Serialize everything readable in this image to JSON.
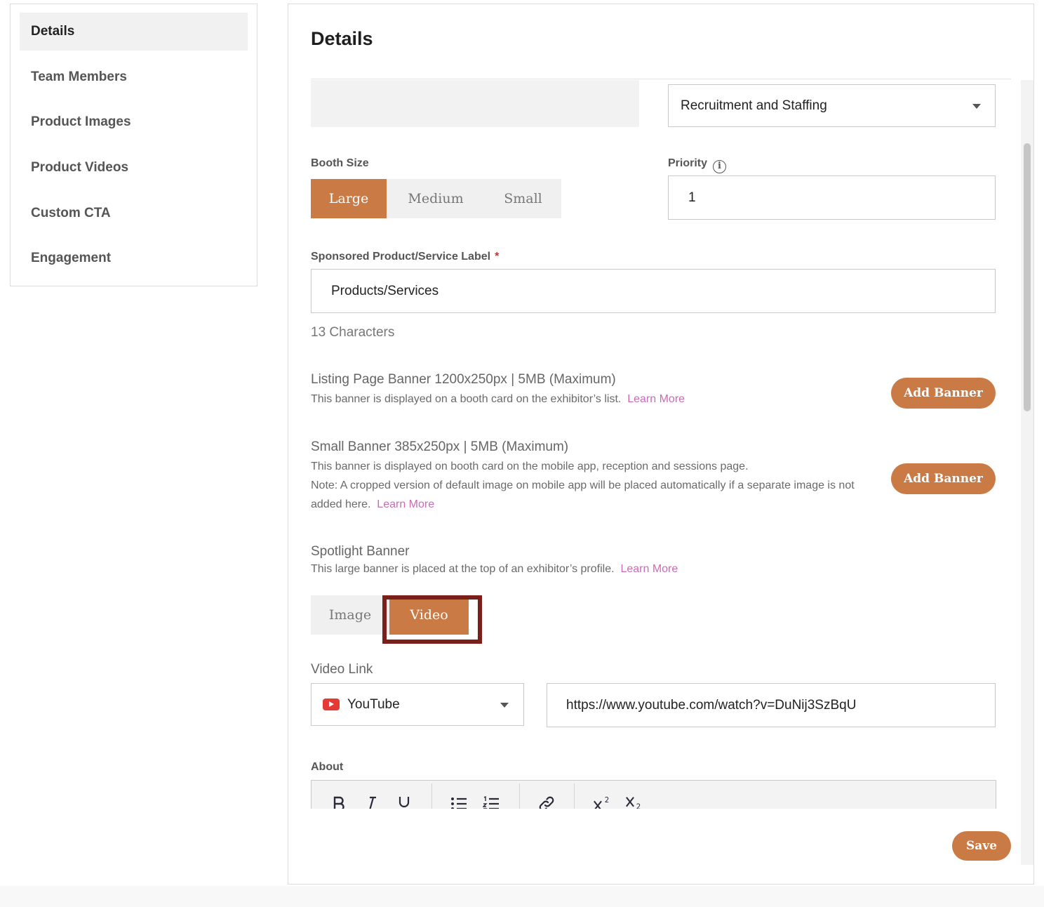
{
  "sidebar": {
    "items": [
      {
        "label": "Details",
        "active": true
      },
      {
        "label": "Team Members"
      },
      {
        "label": "Product Images"
      },
      {
        "label": "Product Videos"
      },
      {
        "label": "Custom CTA"
      },
      {
        "label": "Engagement"
      }
    ]
  },
  "main": {
    "title": "Details",
    "category": {
      "value": "Recruitment and Staffing"
    },
    "booth_size": {
      "label": "Booth Size",
      "options": [
        "Large",
        "Medium",
        "Small"
      ],
      "selected": "Large"
    },
    "priority": {
      "label": "Priority",
      "info_icon": "info-icon",
      "value": "1"
    },
    "sponsored_label": {
      "label": "Sponsored Product/Service Label",
      "required_mark": "*",
      "value": "Products/Services",
      "char_count": "13 Characters"
    },
    "listing_banner": {
      "title": "Listing Page Banner 1200x250px | 5MB (Maximum)",
      "desc": "This banner is displayed on a booth card on the exhibitor’s list.",
      "learn_more": "Learn More",
      "button": "Add Banner"
    },
    "small_banner": {
      "title": "Small Banner 385x250px | 5MB (Maximum)",
      "desc_line1": "This banner is displayed on booth card on the mobile app, reception and sessions page.",
      "desc_line2": "Note: A cropped version of default image on mobile app will be placed automatically if a separate image is not",
      "desc_line3": "added here.",
      "learn_more": "Learn More",
      "button": "Add Banner"
    },
    "spotlight_banner": {
      "title": "Spotlight Banner",
      "desc": "This large banner is placed at the top of an exhibitor’s profile.",
      "learn_more": "Learn More",
      "options": [
        "Image",
        "Video"
      ],
      "selected": "Video"
    },
    "video_link": {
      "label": "Video Link",
      "provider": "YouTube",
      "provider_icon": "youtube-icon",
      "url": "https://www.youtube.com/watch?v=DuNij3SzBqU"
    },
    "about": {
      "label": "About",
      "toolbar": [
        "bold-icon",
        "italic-icon",
        "underline-icon",
        "bullet-list-icon",
        "numbered-list-icon",
        "link-icon",
        "superscript-icon",
        "subscript-icon"
      ]
    },
    "save_button": "Save"
  },
  "colors": {
    "accent": "#c97a45",
    "link": "#c96bb5",
    "highlight": "#7a1f1a",
    "required": "#d32f2f"
  }
}
